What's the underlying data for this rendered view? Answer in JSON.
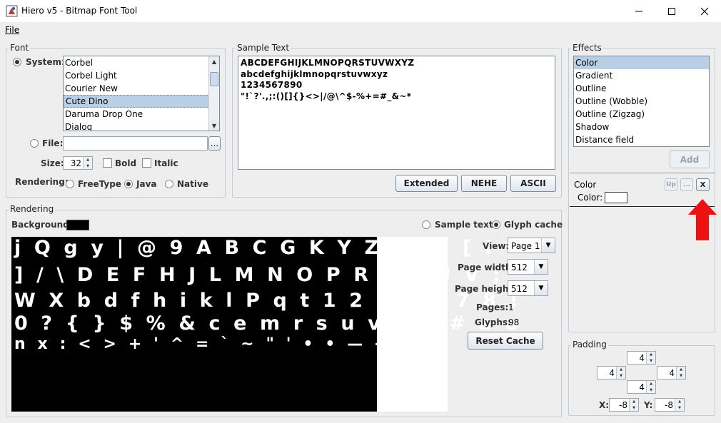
{
  "window": {
    "title": "Hiero v5 - Bitmap Font Tool"
  },
  "menu": {
    "file": "File"
  },
  "font": {
    "group_title": "Font",
    "system_label": "System:",
    "fonts": [
      "Corbel",
      "Corbel Light",
      "Courier New",
      "Cute Dino",
      "Daruma Drop One",
      "Dialog"
    ],
    "selected_font": "Cute Dino",
    "file_label": "File:",
    "file_browse": "...",
    "size_label": "Size:",
    "size_value": "32",
    "bold_label": "Bold",
    "italic_label": "Italic",
    "rendering_label": "Rendering:",
    "freetype_label": "FreeType",
    "java_label": "Java",
    "native_label": "Native",
    "selected_rendering": "Java"
  },
  "sample_text": {
    "group_title": "Sample Text",
    "lines": [
      "ABCDEFGHIJKLMNOPQRSTUVWXYZ",
      "abcdefghijklmnopqrstuvwxyz",
      "1234567890",
      "\"!`?'.,;:()[]{}<>|/@\\^$-%+=#_&~*"
    ],
    "extended_button": "Extended",
    "nehe_button": "NEHE",
    "ascii_button": "ASCII"
  },
  "effects": {
    "group_title": "Effects",
    "items": [
      "Color",
      "Gradient",
      "Outline",
      "Outline (Wobble)",
      "Outline (Zigzag)",
      "Shadow",
      "Distance field"
    ],
    "selected": "Color",
    "add_button": "Add",
    "active_effect": "Color",
    "up_button": "Up",
    "more_button": "...",
    "remove_button": "X",
    "color_label": "Color:",
    "color_value": "#ffffff"
  },
  "padding": {
    "group_title": "Padding",
    "top": "4",
    "left": "4",
    "right": "4",
    "bottom": "4",
    "x_label": "X:",
    "x_value": "-8",
    "y_label": "Y:",
    "y_value": "-8"
  },
  "rendering": {
    "group_title": "Rendering",
    "background_label": "Background:",
    "background_color": "#000000",
    "sample_text_option": "Sample text",
    "glyph_cache_option": "Glyph cache",
    "selected_view_mode": "Glyph cache",
    "glyph_rows": [
      "j Q g y | @ 9 A B C G K Y Z 6 ( ) [ I",
      "] / \\ D E F H J L M N O P R S T U V ;",
      "W X b d f h i k l P q t 1 2 3 4 5 7 8 !",
      "0 ? { } $ % & c e m r s u v w z # a o",
      "n x : < > + ' ^ = ` ~ \" ' • • — -"
    ],
    "view_label": "View:",
    "view_value": "Page 1",
    "page_width_label": "Page width:",
    "page_width_value": "512",
    "page_height_label": "Page height:",
    "page_height_value": "512",
    "pages_label": "Pages:",
    "pages_value": "1",
    "glyphs_label": "Glyphs:",
    "glyphs_value": "98",
    "reset_cache_button": "Reset Cache"
  },
  "annotation": {
    "arrow_color": "#ee1111"
  }
}
